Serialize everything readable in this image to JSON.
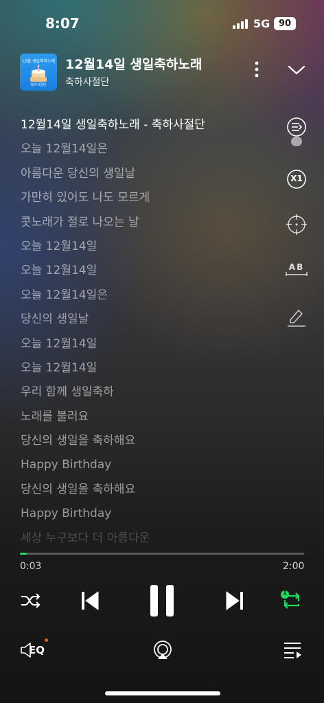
{
  "status_bar": {
    "time": "8:07",
    "network": "5G",
    "battery": "90"
  },
  "now_playing": {
    "title": "12월14일 생일축하노래",
    "artist": "축하사절단",
    "cover_text_top": "12월 생일축하노래",
    "cover_text_bottom": "축하사절단"
  },
  "lyrics": [
    "12월14일 생일축하노래 - 축하사절단",
    "오늘 12월14일은",
    "아름다운 당신의 생일날",
    "가만히 있어도 나도 모르게",
    "콧노래가 절로 나오는 날",
    "오늘 12월14일",
    "오늘 12월14일",
    "오늘 12월14일은",
    "당신의 생일날",
    "오늘 12월14일",
    "오늘 12월14일",
    "우리 함께 생일축하",
    "노래를 불러요",
    "당신의 생일을 축하해요",
    "Happy Birthday",
    "당신의 생일을 축하해요",
    "Happy Birthday",
    "세상 누구보다 더 아름다운"
  ],
  "side_tools": {
    "speed_label": "X1",
    "font_label": "AB"
  },
  "playback": {
    "current_time": "0:03",
    "total_time": "2:00",
    "progress_fraction": 0.025
  },
  "controls": {
    "repeat_badge": "1",
    "eq_label": "EQ"
  },
  "colors": {
    "accent": "#1fd95a",
    "eq_dot": "#ff5a2a"
  }
}
